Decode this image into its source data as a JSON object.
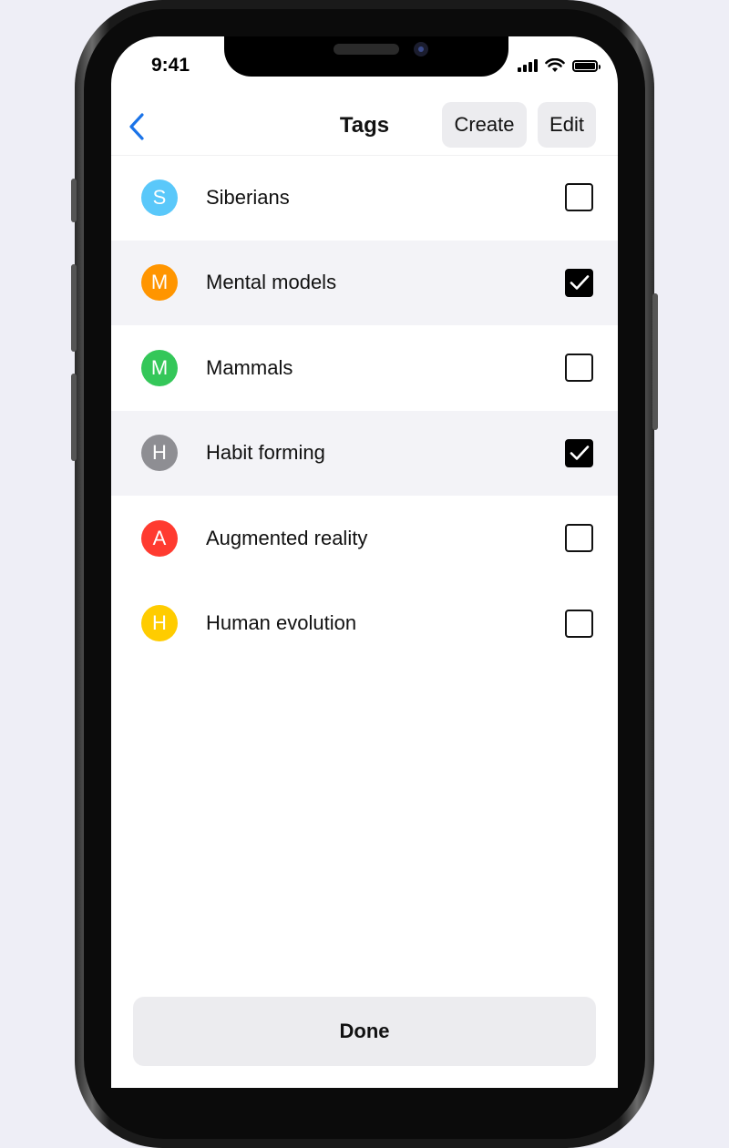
{
  "status_bar": {
    "time": "9:41"
  },
  "nav": {
    "title": "Tags",
    "create_label": "Create",
    "edit_label": "Edit",
    "accent": "#1a73e8"
  },
  "tags": [
    {
      "initial": "S",
      "label": "Siberians",
      "color": "#5ac8fa",
      "checked": false
    },
    {
      "initial": "M",
      "label": "Mental models",
      "color": "#ff9500",
      "checked": true
    },
    {
      "initial": "M",
      "label": "Mammals",
      "color": "#34c759",
      "checked": false
    },
    {
      "initial": "H",
      "label": "Habit forming",
      "color": "#8e8e93",
      "checked": true
    },
    {
      "initial": "A",
      "label": "Augmented reality",
      "color": "#ff3b30",
      "checked": false
    },
    {
      "initial": "H",
      "label": "Human evolution",
      "color": "#ffcc00",
      "checked": false
    }
  ],
  "footer": {
    "done_label": "Done"
  }
}
